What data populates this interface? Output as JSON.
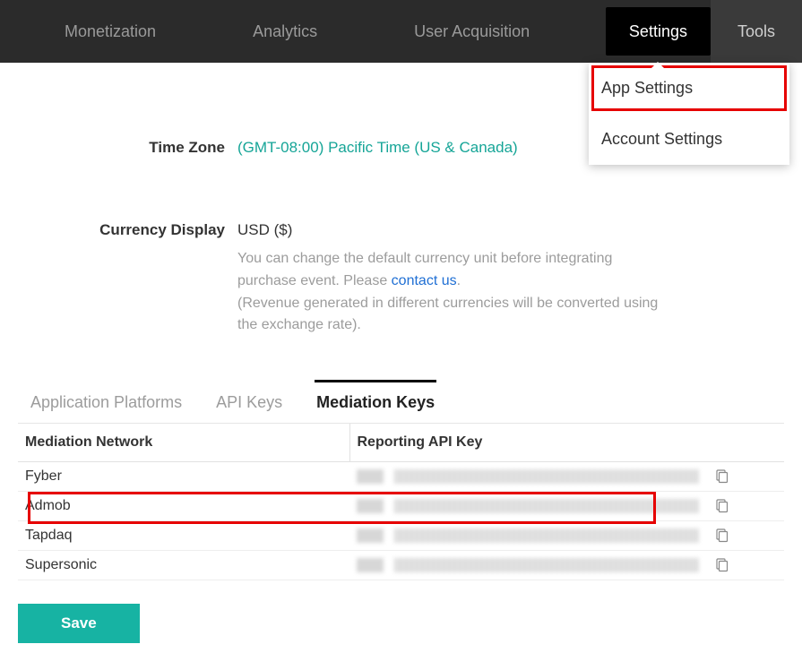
{
  "nav": {
    "items": [
      {
        "label": "Monetization"
      },
      {
        "label": "Analytics"
      },
      {
        "label": "User Acquisition"
      },
      {
        "label": "Settings"
      },
      {
        "label": "Tools"
      }
    ]
  },
  "dropdown": {
    "items": [
      {
        "label": "App Settings"
      },
      {
        "label": "Account Settings"
      }
    ]
  },
  "settings": {
    "timezone_label": "Time Zone",
    "timezone_value": "(GMT-08:00) Pacific Time (US & Canada)",
    "currency_label": "Currency Display",
    "currency_value": "USD ($)",
    "currency_note_1": "You can change the default currency unit before integrating purchase event. Please ",
    "currency_note_link": "contact us",
    "currency_note_1b": ".",
    "currency_note_2": "(Revenue generated in different currencies will be converted using the exchange rate)."
  },
  "tabs": {
    "items": [
      {
        "label": "Application Platforms"
      },
      {
        "label": "API Keys"
      },
      {
        "label": "Mediation Keys"
      }
    ]
  },
  "mediation": {
    "col_network": "Mediation Network",
    "col_key": "Reporting API Key",
    "rows": [
      {
        "name": "Fyber"
      },
      {
        "name": "Admob"
      },
      {
        "name": "Tapdaq"
      },
      {
        "name": "Supersonic"
      }
    ]
  },
  "buttons": {
    "save": "Save"
  }
}
